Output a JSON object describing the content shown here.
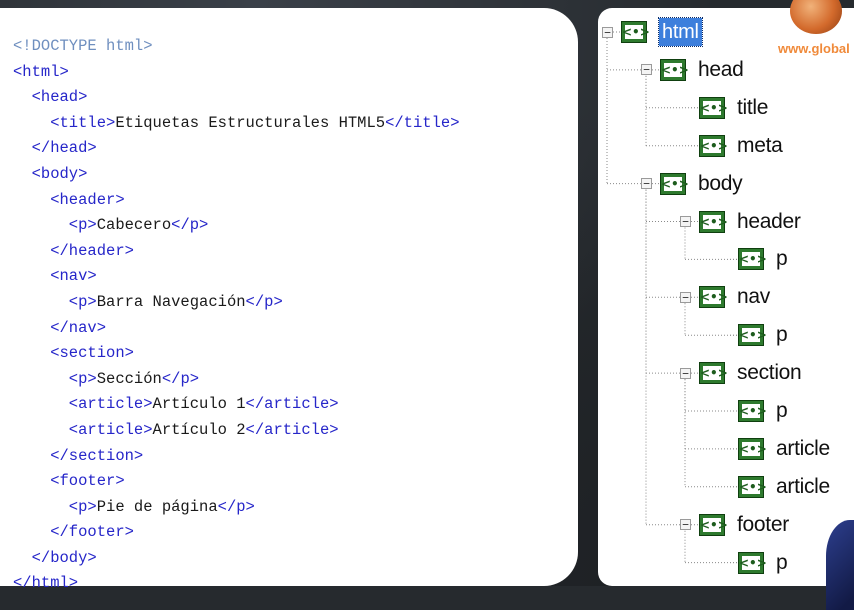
{
  "code": {
    "lines": [
      [
        {
          "t": "<!DOCTYPE html>",
          "c": "doctype"
        }
      ],
      [
        {
          "t": "<html>",
          "c": "tag"
        }
      ],
      [
        {
          "t": "  <head>",
          "c": "tag"
        }
      ],
      [
        {
          "t": "    <title>",
          "c": "tag"
        },
        {
          "t": "Etiquetas Estructurales HTML5",
          "c": "txt"
        },
        {
          "t": "</title>",
          "c": "tag"
        }
      ],
      [
        {
          "t": "  </head>",
          "c": "tag"
        }
      ],
      [
        {
          "t": "  <body>",
          "c": "tag"
        }
      ],
      [
        {
          "t": "    <header>",
          "c": "tag"
        }
      ],
      [
        {
          "t": "      <p>",
          "c": "tag"
        },
        {
          "t": "Cabecero",
          "c": "txt"
        },
        {
          "t": "</p>",
          "c": "tag"
        }
      ],
      [
        {
          "t": "    </header>",
          "c": "tag"
        }
      ],
      [
        {
          "t": "    <nav>",
          "c": "tag"
        }
      ],
      [
        {
          "t": "      <p>",
          "c": "tag"
        },
        {
          "t": "Barra Navegación",
          "c": "txt"
        },
        {
          "t": "</p>",
          "c": "tag"
        }
      ],
      [
        {
          "t": "    </nav>",
          "c": "tag"
        }
      ],
      [
        {
          "t": "    <section>",
          "c": "tag"
        }
      ],
      [
        {
          "t": "      <p>",
          "c": "tag"
        },
        {
          "t": "Sección",
          "c": "txt"
        },
        {
          "t": "</p>",
          "c": "tag"
        }
      ],
      [
        {
          "t": "      <article>",
          "c": "tag"
        },
        {
          "t": "Artículo 1",
          "c": "txt"
        },
        {
          "t": "</article>",
          "c": "tag"
        }
      ],
      [
        {
          "t": "      <article>",
          "c": "tag"
        },
        {
          "t": "Artículo 2",
          "c": "txt"
        },
        {
          "t": "</article>",
          "c": "tag"
        }
      ],
      [
        {
          "t": "    </section>",
          "c": "tag"
        }
      ],
      [
        {
          "t": "    <footer>",
          "c": "tag"
        }
      ],
      [
        {
          "t": "      <p>",
          "c": "tag"
        },
        {
          "t": "Pie de página",
          "c": "txt"
        },
        {
          "t": "</p>",
          "c": "tag"
        }
      ],
      [
        {
          "t": "    </footer>",
          "c": "tag"
        }
      ],
      [
        {
          "t": "  </body>",
          "c": "tag"
        }
      ],
      [
        {
          "t": "</html>",
          "c": "tag"
        }
      ]
    ]
  },
  "tree": {
    "nodes": [
      {
        "label": "html",
        "depth": 0,
        "expanded": true,
        "selected": true
      },
      {
        "label": "head",
        "depth": 1,
        "expanded": true
      },
      {
        "label": "title",
        "depth": 2
      },
      {
        "label": "meta",
        "depth": 2
      },
      {
        "label": "body",
        "depth": 1,
        "expanded": true
      },
      {
        "label": "header",
        "depth": 2,
        "expanded": true
      },
      {
        "label": "p",
        "depth": 3
      },
      {
        "label": "nav",
        "depth": 2,
        "expanded": true
      },
      {
        "label": "p",
        "depth": 3
      },
      {
        "label": "section",
        "depth": 2,
        "expanded": true
      },
      {
        "label": "p",
        "depth": 3
      },
      {
        "label": "article",
        "depth": 3
      },
      {
        "label": "article",
        "depth": 3
      },
      {
        "label": "footer",
        "depth": 2,
        "expanded": true
      },
      {
        "label": "p",
        "depth": 3
      }
    ],
    "toggle_minus": "−",
    "element_icon_glyph": "<•>"
  },
  "logo": {
    "text": "www.global"
  },
  "colors": {
    "tag": "#2626c9",
    "text": "#1a1a1a",
    "doctype": "#6f8fbf",
    "icon": "#2e7a2e",
    "selected": "#3d7fdc"
  }
}
